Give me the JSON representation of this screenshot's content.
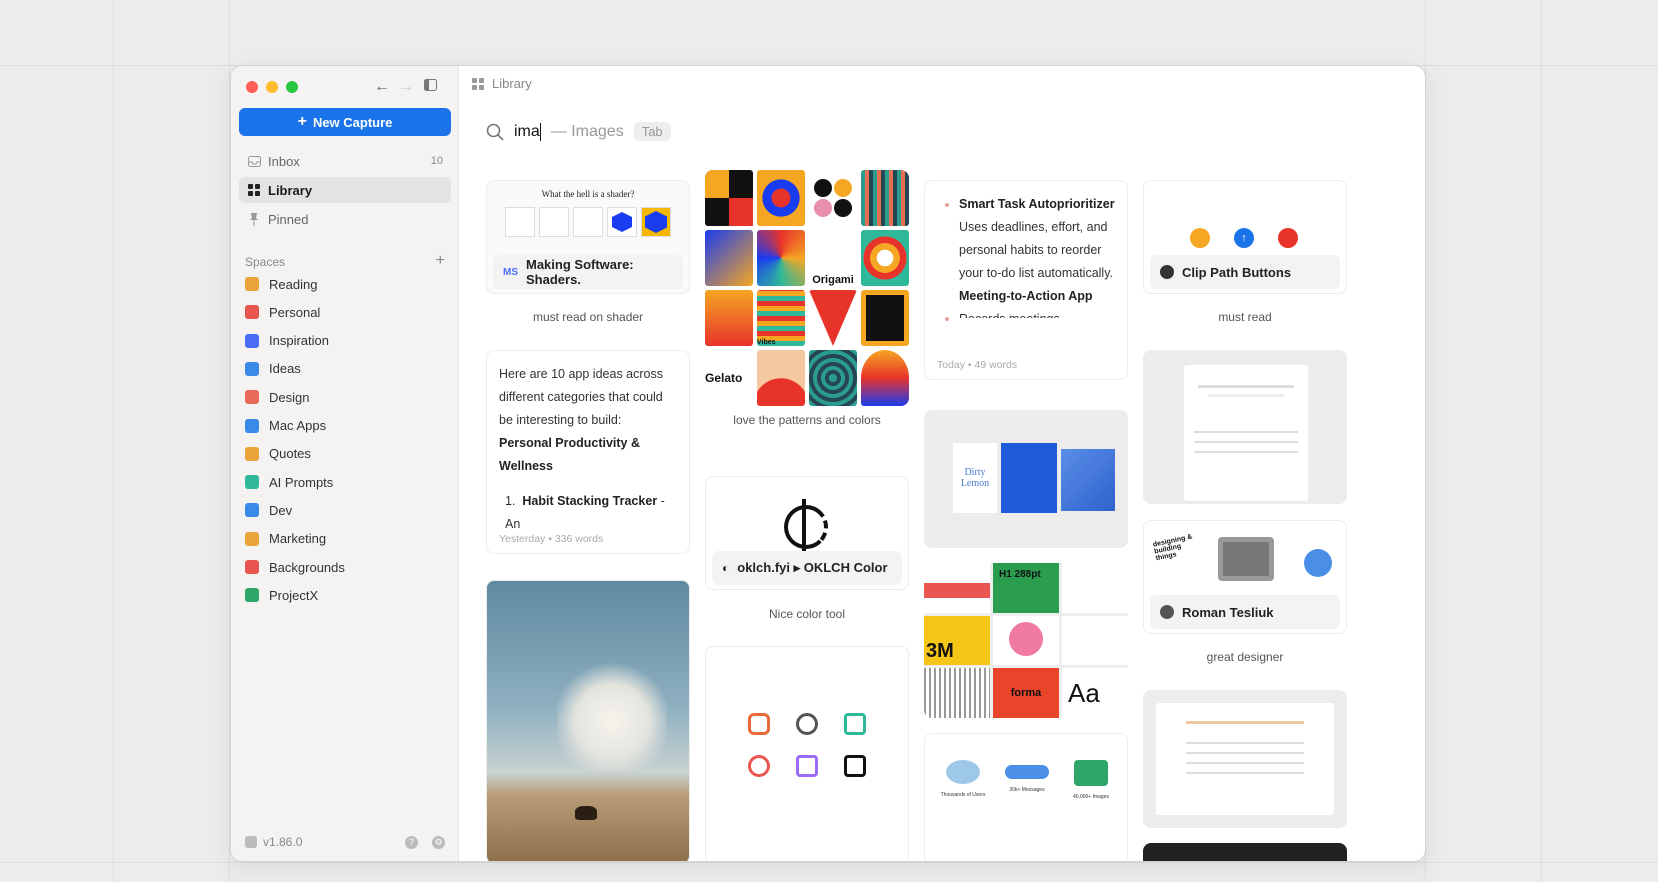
{
  "sidebar": {
    "new_capture": "New Capture",
    "nav": [
      {
        "label": "Inbox",
        "count": "10",
        "icon": "inbox-icon"
      },
      {
        "label": "Library",
        "count": "",
        "icon": "grid-icon"
      },
      {
        "label": "Pinned",
        "count": "",
        "icon": "pin-icon"
      }
    ],
    "spaces_title": "Spaces",
    "spaces": [
      {
        "label": "Reading",
        "color": "#e8a33a"
      },
      {
        "label": "Personal",
        "color": "#e8564f"
      },
      {
        "label": "Inspiration",
        "color": "#4a6cf7"
      },
      {
        "label": "Ideas",
        "color": "#3a8be8"
      },
      {
        "label": "Design",
        "color": "#e86a5a"
      },
      {
        "label": "Mac Apps",
        "color": "#3a8be8"
      },
      {
        "label": "Quotes",
        "color": "#e8a33a"
      },
      {
        "label": "AI Prompts",
        "color": "#2fb89a"
      },
      {
        "label": "Dev",
        "color": "#3a8be8"
      },
      {
        "label": "Marketing",
        "color": "#e8a33a"
      },
      {
        "label": "Backgrounds",
        "color": "#e8564f"
      },
      {
        "label": "ProjectX",
        "color": "#2fa56a"
      }
    ],
    "version": "v1.86.0"
  },
  "topbar": {
    "title": "Library"
  },
  "search": {
    "query": "ima",
    "hint": "— Images",
    "tab_key": "Tab"
  },
  "cards": {
    "shader": {
      "title": "What the hell is a shader?",
      "badge": "MS",
      "link": "Making Software: Shaders.",
      "caption": "must read on shader"
    },
    "patterns": {
      "caption": "love the patterns and colors",
      "words": [
        "Origami",
        "Gelato",
        "Vibes"
      ]
    },
    "tasks": {
      "items": [
        {
          "title": "Smart Task Autoprioritizer",
          "body": "Uses deadlines, effort, and personal habits to reorder your to-do list automatically."
        },
        {
          "title": "Meeting-to-Action App",
          "body": "Records meetings"
        }
      ],
      "meta": "Today • 49 words"
    },
    "clip": {
      "link": "Clip Path Buttons",
      "caption": "must read"
    },
    "ideas": {
      "intro": "Here are 10 app ideas across different categories that could be interesting to build:",
      "heading": "Personal Productivity & Wellness",
      "item": "Habit Stacking Tracker",
      "item_rest": "- An",
      "meta": "Yesterday • 336 words"
    },
    "oklch": {
      "link": "oklch.fyi ▸ OKLCH Color",
      "caption": "Nice color tool"
    },
    "dirty": {
      "text": "Dirty Lemon"
    },
    "forma": {
      "big": "3M",
      "label": "H1 288pt",
      "aa": "Aa",
      "brand": "forma"
    },
    "roman": {
      "link": "Roman Tesliuk",
      "caption": "great designer",
      "sticker": "designing & building things"
    },
    "stats": {
      "items": [
        "Thousands of Users",
        "30k+ Messages",
        "40,000+ Images"
      ]
    }
  }
}
